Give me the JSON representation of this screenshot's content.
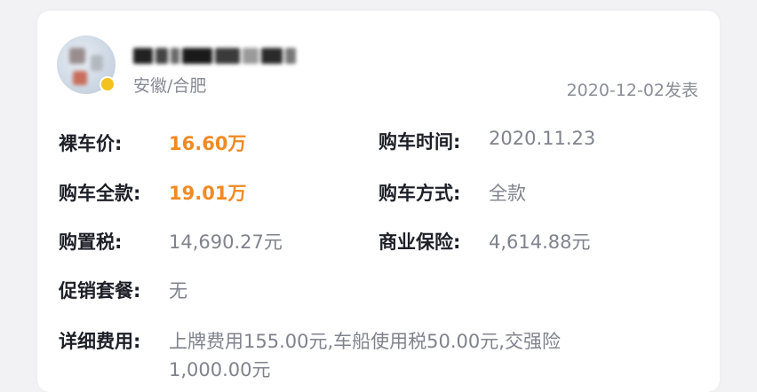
{
  "review": {
    "location": "安徽/合肥",
    "post_date": "2020-12-02发表",
    "fields": {
      "bare_price": {
        "label": "裸车价:",
        "value": "16.60万"
      },
      "purchase_time": {
        "label": "购车时间:",
        "value": "2020.11.23"
      },
      "full_price": {
        "label": "购车全款:",
        "value": "19.01万"
      },
      "purchase_method": {
        "label": "购车方式:",
        "value": "全款"
      },
      "purchase_tax": {
        "label": "购置税:",
        "value": "14,690.27元"
      },
      "commercial_insurance": {
        "label": "商业保险:",
        "value": "4,614.88元"
      },
      "promotion": {
        "label": "促销套餐:",
        "value": "无"
      },
      "detailed_cost": {
        "label": "详细费用:",
        "line1": "上牌费用155.00元,车船使用税50.00元,交强险",
        "line2": "1,000.00元"
      }
    }
  },
  "colors": {
    "accent_orange": "#f08a24",
    "label_dark": "#1e2028",
    "value_gray": "#80838c",
    "badge_yellow": "#f4c21e"
  },
  "icons": {
    "avatar": "user-avatar-blurred",
    "badge": "verified-badge-icon"
  }
}
